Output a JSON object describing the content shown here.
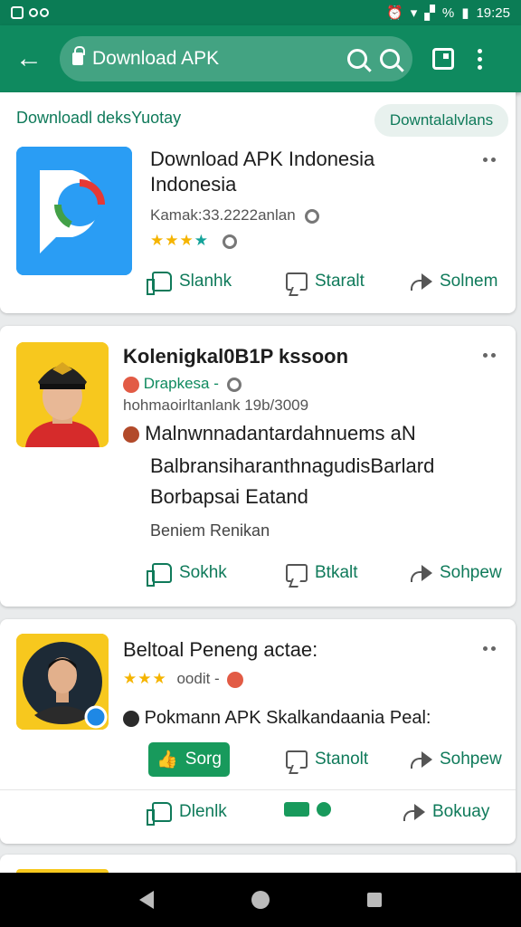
{
  "status_bar": {
    "time": "19:25",
    "pct": "%"
  },
  "toolbar": {
    "url": "Download APK"
  },
  "header": {
    "breadcrumb": "Downloadl deksYuotay",
    "chip": "Downtalalvlans"
  },
  "cards": [
    {
      "title_line1": "Download APK Indonesia",
      "title_line2": "Indonesia",
      "meta": "Kamak:33.2222anlan",
      "actions": [
        "Slanhk",
        "Staralt",
        "Solnem"
      ]
    },
    {
      "title": "Kolenigkal0B1P kssoon",
      "author": "Drapkesa -",
      "meta": "hohmaoirltanlank  19b/3009",
      "line1": "Malnwnnadantardahnuems aN",
      "line2": "BalbransiharanthnagudisBarlard",
      "line3": "Borbapsai Eatand",
      "line4": "Beniem Renikan",
      "actions": [
        "Sokhk",
        "Btkalt",
        "Sohpew"
      ]
    },
    {
      "title": "Beltoal Peneng actae:",
      "meta": "oodit -",
      "line1": "Pokmann APK Skalkandaania Peal:",
      "button": "Sorg",
      "actions": [
        "Stanolt",
        "Sohpew",
        "Dlenlk",
        "Bokuay"
      ]
    }
  ],
  "colors": {
    "primary": "#0f8a5f",
    "statusbar": "#0b7c55",
    "accent_green": "#189a5c",
    "star": "#f5b400"
  }
}
